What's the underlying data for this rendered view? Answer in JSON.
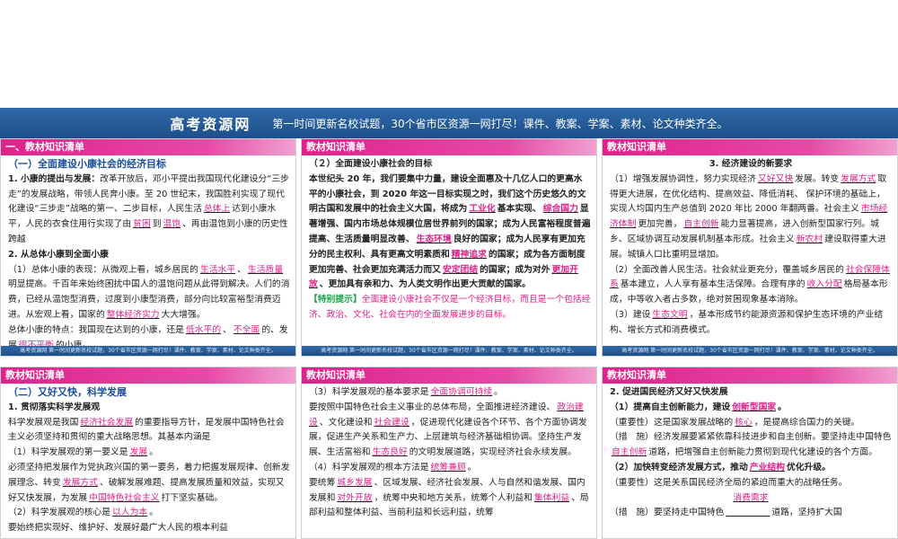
{
  "banner": {
    "title": "高考资源网",
    "tagline": "第一时间更新名校试题，30个省市区资源一网打尽！课件、教案、学案、素材、论文种类齐全。"
  },
  "footer_text": "高考资源网      第一时间更新名校试题，30个省市区资源一网打尽！课件、教案、学案、素材、论文种类齐全。",
  "slides": {
    "s1": {
      "header": "一、教材知识清单",
      "section_title": "（一）全面建设小康社会的经济目标",
      "h1": "1. 小康的提出与发展：",
      "p1a": "改革开放后，邓小平提出我国现代化建设分“三步走”的发展战略，带领人民奔小康。至 20 世纪末，我国胜利实现了现代化建设“三步走”战略的第一、二步目标，人民生活",
      "f1": "总体上",
      "p1b": "达到小康水平，人民的衣食住用行实现了由",
      "f2": "贫困",
      "p1c": "到",
      "f3": "温饱",
      "p1d": "、再由温饱到小康的历史性跨越",
      "h2": "2. 从总体小康到全面小康",
      "p2a": "（1）总体小康的表现：从微观上看，城乡居民的",
      "f4": "生活水平",
      "p2b": "、",
      "f5": "生活质量",
      "p2c": "明显提高。千百年来始终困扰中国人的温饱问题从此得到解决。人们的消费，已经从温饱型消费，过度到小康型消费，部分向比较富裕型消费迈进。从宏观上看，国家的",
      "f6": "整体经济实力",
      "p2d": "大大增强。",
      "p3a": "总体小康的特点：我国现在达到的小康，还是",
      "f7": "低水平的",
      "p3b": "、",
      "f8": "不全面",
      "p3c": "的、发展",
      "f9": "很不平衡",
      "p3d": "的小康。"
    },
    "s2": {
      "header": "教材知识清单",
      "title": "（２）全面建设小康社会的目标",
      "t1": "本世纪头 20 年，我们要集中力量，建设全面惠及十几亿人口的更高水平的小康社会，到 2020 年这一目标实现之时，我们这个历史悠久的文明古国和发展中的社会主义大国，将成为",
      "f1": "工业化",
      "t2": "基本实现、",
      "f2": "综合国力",
      "t3": "显著增强、国内市场总体规模位居世界前列的国家；成为人民富裕程度普遍提高、生活质量明显改善、",
      "f3": "生态环境",
      "t4": "良好的国家；成为人民享有更加充分的民主权利、具有更高文明素质和",
      "f4": "精神追求",
      "t5": "的国家；成为各方面制度更加完善、社会更加充满活力而又",
      "f5": "安定团结",
      "t6": "的国家；成为对外",
      "f6": "更加开放",
      "t7": "、更加具有亲和力、为人类文明作出更大贡献的国家。",
      "tip_label": "【特别提示】",
      "tip": "全面建设小康社会不仅是一个经济目标，而且是一个包括经济、政治、文化、社会在内的全面发展进步的目标。"
    },
    "s3": {
      "header": "教材知识清单",
      "h1": "3. 经济建设的新要求",
      "p1a": "（1）增强发展协调性，努力实现经济",
      "f1": "又好又快",
      "p1b": "发展。转变",
      "f2": "发展方式",
      "p1c": "取得更大进展，在优化结构、提高效益、降低消耗、 保护环境的基础上， 实现人均国内生产总值到 2020 年比 2000 年翻两番。社会主义",
      "f3": "市场经济体制",
      "p1d": "更加完善，",
      "f4": "自主创新",
      "p1e": "能力显著提高，进入创新型国家行列。城乡、区域协调互动发展机制基本形成。社会主义",
      "f5": "新农村",
      "p1f": "建设取得重大进展。城镇人口比重明显增加。",
      "p2a": "（2）全面改善人民生活。社会就业更充分，覆盖城乡居民的",
      "f6": "社会保障体系",
      "p2b": "基本建立，人人享有基本生活保障。合理有序的",
      "f7": "收入分配",
      "p2c": "格局基本形成，中等收入者占多数，绝对贫困现象基本消除。",
      "p3a": "（3）建设",
      "f8": "生态文明",
      "p3b": "，基本形成节约能源资源和保护生态环境的产业结构、增长方式和消费模式。"
    },
    "s4": {
      "header": "教材知识清单",
      "section_title": "（二）又好又快，科学发展",
      "h1": "1. 贯彻落实科学发展观",
      "p1a": "科学发展观是我国",
      "f1": "经济社会发展",
      "p1b": "的重要指导方针，是发展中国特色社会主义必须坚持和贯彻的重大战略思想。其基本内涵是",
      "p2a": "（1）科学发展观的第一要义是",
      "f2": "发展",
      "p2b": "。",
      "p3a": "必须坚持把发展作为党执政兴国的第一要务，着力把握发展规律、创新发展理念、转变",
      "f3": "发展方式",
      "p3b": "、破解发展难题、提高发展质量和效益，实现又好又快发展，为发展",
      "f4": "中国特色社会主义",
      "p3c": "打下坚实基础。",
      "p4a": "（2）科学发展观的核心是",
      "f5": "以人为本",
      "p4b": "。",
      "p5": "要始终把实现好、维护好、发展好最广大人民的根本利益"
    },
    "s5": {
      "header": "教材知识清单",
      "p1a": "（3）科学发展观的基本要求是",
      "f1": "全面协调可持续",
      "p1b": "。",
      "p2a": "要按照中国特色社会主义事业的总体布局，全面推进经济建设、",
      "f2": "政治建设",
      "p2b": "、文化建设和",
      "f3": "社会建设",
      "p2c": "，促进现代化建设各个环节、各个方面协调发展，促进生产关系和生产力、上层建筑与经济基础相协调。坚持生产发展、生活富裕和",
      "f4": "生态良好",
      "p2d": "的文明发展道路，实现经济社会永续发展。",
      "p3a": "（4）科学发展观的根本方法是",
      "f5": "统筹兼顾",
      "p3b": "。",
      "p4a": "要统筹",
      "f6": "城乡发展",
      "p4b": "、区域发展、经济社会发展、人与自然和谐发展、国内发展和",
      "f7": "对外开放",
      "p4c": "，统筹中央和地方关系，统筹个人利益和",
      "f8": "集体利益",
      "p4d": "、局部利益和整体利益、当前利益和长远利益，统筹"
    },
    "s6": {
      "header": "教材知识清单",
      "h1": "2. 促进国民经济又好又快发展",
      "p1a": "（1）提高自主创新能力，建设",
      "f1": "创新型国家",
      "p1b": "。",
      "p2a": "（重要性）这是国家发展战略的",
      "f2": "核心",
      "p2b": "，是提高综合国力的关键。",
      "p3a": "（措　施）经济发展要紧紧依靠科技进步和自主创新。要坚持走中国特色",
      "f3": "自主创新",
      "p3b": "道路，把增强自主创新能力贯彻到现代化建设的各个方面。",
      "p4a": "（2）加快转变经济发展方式，推动",
      "f4": "产业结构",
      "p4b": "优化升级。",
      "p5a": "（重要性）这是关系国民经济全局的紧迫而重大的战略任务。",
      "f5": "消费需求",
      "p6a": "（措　施）要坚持走中国特色",
      "p6b": "道路，坚持扩大国"
    }
  }
}
